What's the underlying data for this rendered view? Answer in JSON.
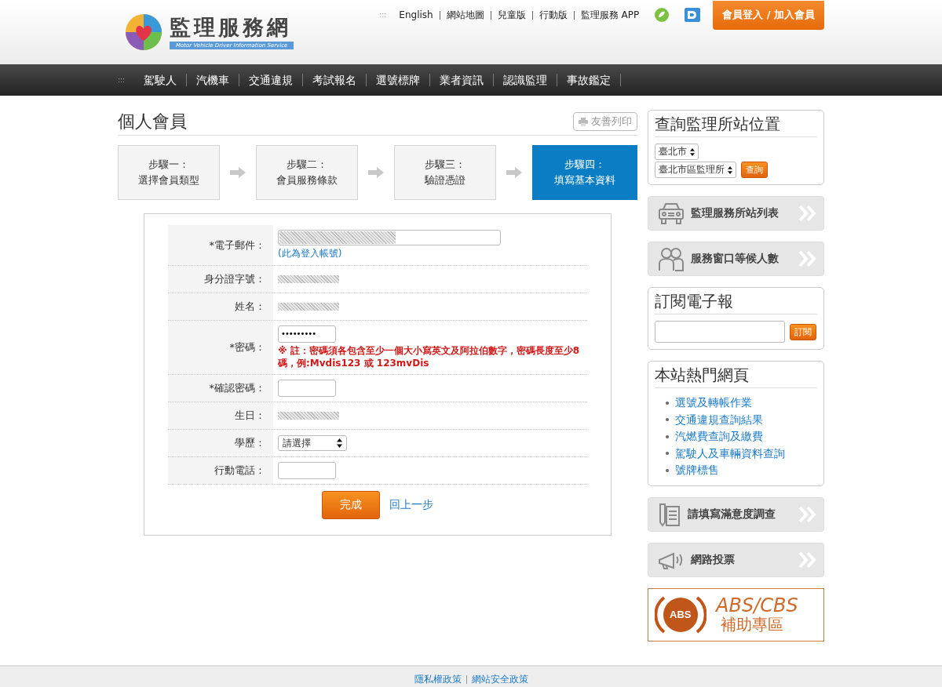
{
  "header": {
    "logo_title": "監理服務網",
    "logo_subtitle": "Motor Vehicle Driver Information Service",
    "links_marker": ":::",
    "links": [
      "English",
      "網站地圖",
      "兒童版",
      "行動版",
      "監理服務 APP"
    ],
    "login_button": "會員登入 / 加入會員"
  },
  "nav": {
    "marker": ":::",
    "items": [
      "駕駛人",
      "汽機車",
      "交通違規",
      "考試報名",
      "選號標牌",
      "業者資訊",
      "認識監理",
      "事故鑑定"
    ]
  },
  "page_title": "個人會員",
  "print_button": "友善列印",
  "steps": [
    {
      "step": "步驟一：",
      "label": "選擇會員類型",
      "selected": false
    },
    {
      "step": "步驟二：",
      "label": "會員服務條款",
      "selected": false
    },
    {
      "step": "步驟三：",
      "label": "驗證憑證",
      "selected": false
    },
    {
      "step": "步驟四：",
      "label": "填寫基本資料",
      "selected": true
    }
  ],
  "form": {
    "rows": [
      {
        "label": "*電子郵件：",
        "kind": "email",
        "hint": "(此為登入帳號)"
      },
      {
        "label": "身分證字號：",
        "kind": "redacted"
      },
      {
        "label": "姓名：",
        "kind": "redacted"
      },
      {
        "label": "*密碼：",
        "kind": "password",
        "value": "•••••••••",
        "note": "※ 註：密碼須各包含至少一個大小寫英文及阿拉伯數字，密碼長度至少8碼，例:Mvdis123 或 123mvDis"
      },
      {
        "label": "*確認密碼：",
        "kind": "input"
      },
      {
        "label": "生日：",
        "kind": "redacted"
      },
      {
        "label": "學歷：",
        "kind": "select",
        "value": "請選擇"
      },
      {
        "label": "行動電話：",
        "kind": "input"
      }
    ],
    "submit": "完成",
    "back_link": "回上一步"
  },
  "sidebar": {
    "locate": {
      "title": "查詢監理所站位置",
      "city": "臺北市",
      "office": "臺北市區監理所",
      "button": "查詢"
    },
    "links": [
      {
        "kind": "car",
        "label": "監理服務所站列表"
      },
      {
        "kind": "people",
        "label": "服務窗口等候人數"
      }
    ],
    "newsletter": {
      "title": "訂閱電子報",
      "button": "訂閱"
    },
    "popular": {
      "title": "本站熱門網頁",
      "items": [
        "選號及轉帳作業",
        "交通違規查詢結果",
        "汽燃費查詢及繳費",
        "駕駛人及車輛資料查詢",
        "號牌標售"
      ]
    },
    "links_2": [
      {
        "kind": "document",
        "label": "請填寫滿意度調查"
      },
      {
        "kind": "megaphone",
        "label": "網路投票"
      }
    ],
    "banner": {
      "badge": "ABS",
      "title": "ABS/CBS",
      "subtitle": "補助專區"
    }
  },
  "footer": {
    "links": [
      "隱私權政策",
      "網站安全政策"
    ]
  }
}
